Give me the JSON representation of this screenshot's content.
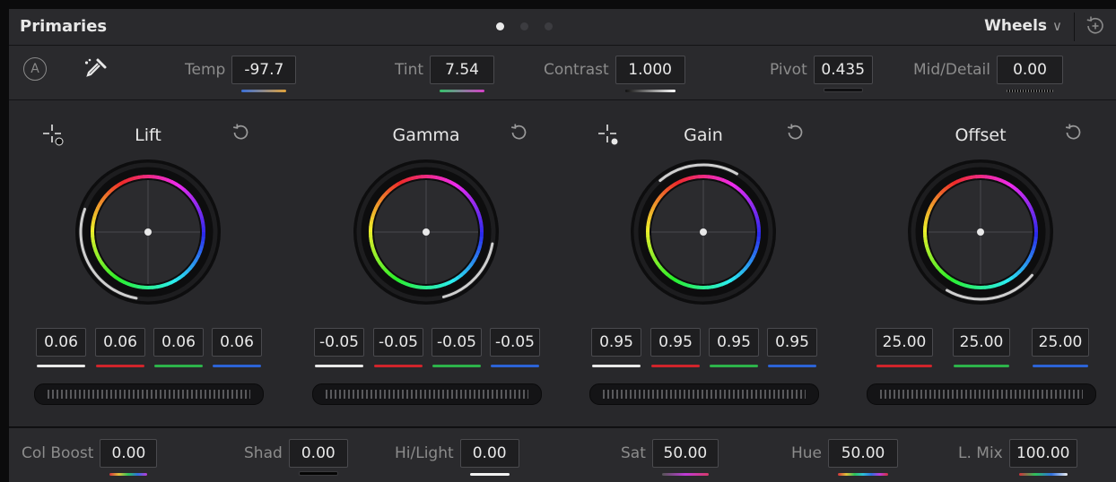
{
  "header": {
    "title": "Primaries",
    "mode": "Wheels",
    "mode_chevron": "∨",
    "pages": 3,
    "active_page": 1
  },
  "top_params": {
    "auto_label": "A",
    "temp": {
      "label": "Temp",
      "value": "-97.7"
    },
    "tint": {
      "label": "Tint",
      "value": "7.54"
    },
    "contrast": {
      "label": "Contrast",
      "value": "1.000"
    },
    "pivot": {
      "label": "Pivot",
      "value": "0.435"
    },
    "middetail": {
      "label": "Mid/Detail",
      "value": "0.00"
    }
  },
  "wheels": [
    {
      "title": "Lift",
      "values": [
        "0.06",
        "0.06",
        "0.06",
        "0.06"
      ]
    },
    {
      "title": "Gamma",
      "values": [
        "-0.05",
        "-0.05",
        "-0.05",
        "-0.05"
      ]
    },
    {
      "title": "Gain",
      "values": [
        "0.95",
        "0.95",
        "0.95",
        "0.95"
      ]
    },
    {
      "title": "Offset",
      "values": [
        "25.00",
        "25.00",
        "25.00"
      ]
    }
  ],
  "bottom_params": {
    "colboost": {
      "label": "Col Boost",
      "value": "0.00"
    },
    "shad": {
      "label": "Shad",
      "value": "0.00"
    },
    "hilight": {
      "label": "Hi/Light",
      "value": "0.00"
    },
    "sat": {
      "label": "Sat",
      "value": "50.00"
    },
    "hue": {
      "label": "Hue",
      "value": "50.00"
    },
    "lmix": {
      "label": "L. Mix",
      "value": "100.00"
    }
  },
  "colors": {
    "channel_white": "#e8e8e8",
    "channel_red": "#d0242b",
    "channel_green": "#2db34a",
    "channel_blue": "#2c63d6"
  },
  "icons": {
    "auto_balance": "circle-a-icon",
    "picker": "eyedropper-icon",
    "reset": "reset-icon",
    "reset_all": "reset-all-icon",
    "crosshair": "crosshair-icon"
  }
}
